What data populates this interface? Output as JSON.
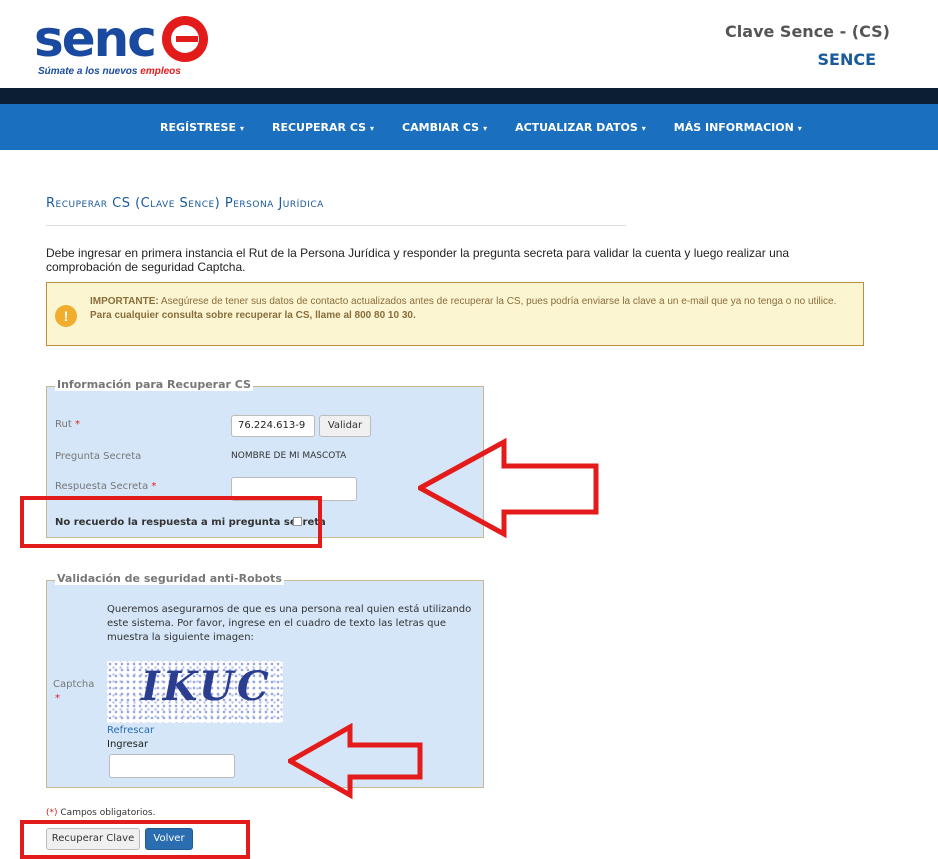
{
  "header": {
    "logo_word": "senc",
    "logo_tag_main": "Súmate a los nuevos ",
    "logo_tag_accent": "empleos",
    "app_title": "Clave Sence - (CS)",
    "app_subtitle": "SENCE"
  },
  "nav": {
    "items": [
      {
        "label": "REGÍSTRESE"
      },
      {
        "label": "RECUPERAR CS"
      },
      {
        "label": "CAMBIAR CS"
      },
      {
        "label": "ACTUALIZAR DATOS"
      },
      {
        "label": "MÁS INFORMACION"
      }
    ],
    "caret": "▾"
  },
  "page": {
    "heading": "Recuperar CS (Clave Sence) Persona Jurídica",
    "intro": "Debe ingresar en primera instancia el Rut de la Persona Jurídica y responder la pregunta secreta para validar la cuenta y luego realizar una comprobación de seguridad Captcha."
  },
  "alert": {
    "icon": "!",
    "bold_lead": "IMPORTANTE:",
    "text": " Asegúrese de tener sus datos de contacto actualizados antes de recuperar la CS, pues podría enviarse la clave a un e-mail que ya no tenga o no utilice. ",
    "bold_tail": "Para cualquier consulta sobre recuperar la CS, llame al 800 80 10 30."
  },
  "recover_form": {
    "legend": "Información para Recuperar CS",
    "rut_label": "Rut",
    "rut_value": "76.224.613-9",
    "validate_label": "Validar",
    "question_label": "Pregunta Secreta",
    "question_value": "NOMBRE DE MI MASCOTA",
    "answer_label": "Respuesta Secreta",
    "answer_value": "",
    "forgot_label": "No recuerdo la respuesta a mi pregunta secreta",
    "required_mark": "*"
  },
  "captcha_form": {
    "legend": "Validación de seguridad anti-Robots",
    "intro": "Queremos asegurarnos de que es una persona real quien está utilizando este sistema. Por favor, ingrese en el cuadro de texto las letras que muestra la siguiente imagen:",
    "captcha_label": "Captcha",
    "captcha_text": "IKUC",
    "refresh_label": "Refrescar",
    "enter_label": "Ingresar",
    "enter_value": ""
  },
  "footer": {
    "required_note_mark": "(*)",
    "required_note": " Campos obligatorios.",
    "recover_button": "Recuperar Clave",
    "back_button": "Volver"
  },
  "colors": {
    "brand_blue": "#1a6fbf",
    "top_bar": "#0c1e33",
    "annotation_red": "#e41b1b",
    "fieldset_bg": "#d4e6f7",
    "alert_bg": "#fcf5d2"
  }
}
